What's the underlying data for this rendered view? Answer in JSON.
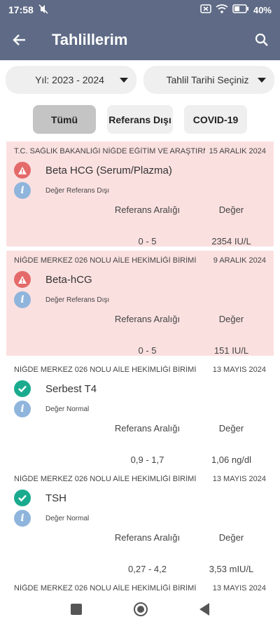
{
  "statusbar": {
    "time": "17:58",
    "battery": "40%"
  },
  "appbar": {
    "title": "Tahlillerim"
  },
  "filters": {
    "year": "Yıl: 2023 - 2024",
    "date": "Tahlil Tarihi Seçiniz"
  },
  "tabs": [
    {
      "label": "Tümü"
    },
    {
      "label": "Referans Dışı"
    },
    {
      "label": "COVID-19"
    }
  ],
  "columns": {
    "range": "Referans Aralığı",
    "value": "Değer"
  },
  "results": [
    {
      "lab": "T.C. SAĞLIK BAKANLIĞI NİĞDE EĞİTİM VE ARAŞTIRMA",
      "date": "15 ARALIK 2024",
      "test": "Beta HCG (Serum/Plazma)",
      "status": "Değer Referans Dışı",
      "range": "0 - 5",
      "value": "2354 IU/L"
    },
    {
      "lab": "NİĞDE MERKEZ 026 NOLU AİLE HEKİMLİĞİ BİRİMİ",
      "date": "9 ARALIK 2024",
      "test": "Beta-hCG",
      "status": "Değer Referans Dışı",
      "range": "0 - 5",
      "value": "151 IU/L"
    },
    {
      "lab": "NİĞDE MERKEZ 026 NOLU AİLE HEKİMLİĞİ BİRİMİ",
      "date": "13 MAYIS 2024",
      "test": "Serbest T4",
      "status": "Değer Normal",
      "range": "0,9 - 1,7",
      "value": "1,06 ng/dl"
    },
    {
      "lab": "NİĞDE MERKEZ 026 NOLU AİLE HEKİMLİĞİ BİRİMİ",
      "date": "13 MAYIS 2024",
      "test": "TSH",
      "status": "Değer Normal",
      "range": "0,27 - 4,2",
      "value": "3,53 mIU/L"
    },
    {
      "lab": "NİĞDE MERKEZ 026 NOLU AİLE HEKİMLİĞİ BİRİMİ",
      "date": "13 MAYIS 2024"
    }
  ],
  "colors": {
    "appbar": "#5f6b86",
    "alert_card": "#fbe0e0",
    "warning": "#e46a6a",
    "ok": "#1aab8e",
    "info": "#8fb5dc"
  }
}
